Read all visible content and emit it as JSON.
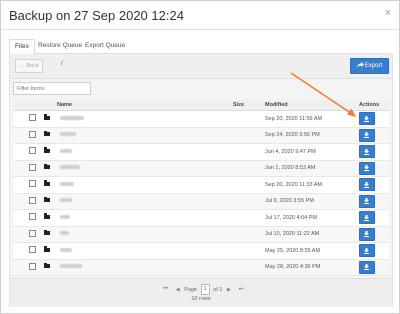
{
  "modal": {
    "title": "Backup on 27 Sep 2020 12:24",
    "close_symbol": "×"
  },
  "tabs": [
    {
      "label": "Files",
      "active": true
    },
    {
      "label": "Restore Queue",
      "active": false
    },
    {
      "label": "Export Queue",
      "active": false
    }
  ],
  "toolbar": {
    "back_label": "← Back",
    "path": "/",
    "export_label": "Export",
    "export_icon": "share-arrow-icon"
  },
  "filter": {
    "placeholder": "Filter Items"
  },
  "table": {
    "columns": {
      "name": "Name",
      "size": "Size",
      "modified": "Modified",
      "actions": "Actions"
    },
    "rows": [
      {
        "modified": "Sep 20, 2020 11:56 AM"
      },
      {
        "modified": "Sep 24, 2020 3:56 PM"
      },
      {
        "modified": "Jun 4, 2020 9:47 PM"
      },
      {
        "modified": "Jun 1, 2020 8:53 AM"
      },
      {
        "modified": "Sep 20, 2020 11:33 AM"
      },
      {
        "modified": "Jul 9, 2020 3:55 PM"
      },
      {
        "modified": "Jul 17, 2020 4:04 PM"
      },
      {
        "modified": "Jul 10, 2020 11:22 AM"
      },
      {
        "modified": "May 25, 2020 8:55 AM"
      },
      {
        "modified": "May 28, 2020 4:36 PM"
      }
    ]
  },
  "pagination": {
    "first_symbol": "⏮",
    "prev_symbol": "◀",
    "page_label": "Page",
    "page_value": "1",
    "of_label": "of 1",
    "next_symbol": "▶",
    "last_symbol": "⏭",
    "rows_label": "10 rows"
  },
  "colors": {
    "accent": "#3a7dc9",
    "annotation_arrow": "#f07a3a"
  }
}
